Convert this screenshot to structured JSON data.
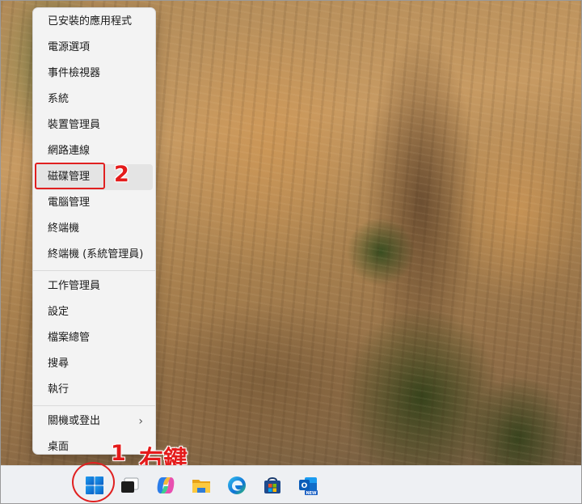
{
  "context_menu": {
    "items": [
      {
        "label": "已安裝的應用程式"
      },
      {
        "label": "電源選項"
      },
      {
        "label": "事件檢視器"
      },
      {
        "label": "系統"
      },
      {
        "label": "裝置管理員"
      },
      {
        "label": "網路連線"
      },
      {
        "label": "磁碟管理"
      },
      {
        "label": "電腦管理"
      },
      {
        "label": "終端機"
      },
      {
        "label": "終端機 (系統管理員)"
      },
      {
        "label": "工作管理員"
      },
      {
        "label": "設定"
      },
      {
        "label": "檔案總管"
      },
      {
        "label": "搜尋"
      },
      {
        "label": "執行"
      },
      {
        "label": "關機或登出"
      },
      {
        "label": "桌面"
      }
    ]
  },
  "annotations": {
    "step1": "1",
    "step1_text": "右鍵",
    "step2": "2",
    "color": "#e41b1b"
  },
  "taskbar": {
    "icons": [
      "windows-start-icon",
      "task-view-icon",
      "copilot-icon",
      "file-explorer-icon",
      "edge-icon",
      "microsoft-store-icon",
      "outlook-new-icon"
    ],
    "outlook_badge": "NEW"
  }
}
